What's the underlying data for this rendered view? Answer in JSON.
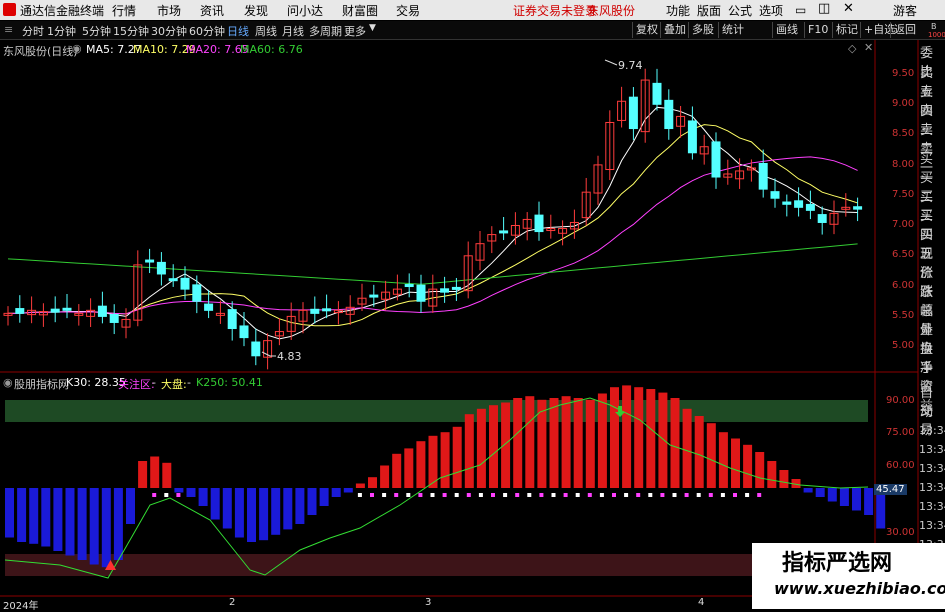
{
  "menubar": {
    "app_title": "通达信金融终端",
    "menus": [
      "行情",
      "市场",
      "资讯",
      "发现",
      "问小达",
      "财富圈",
      "交易"
    ],
    "notice": "证券交易未登录",
    "stock": "东风股份",
    "right": [
      "功能",
      "版面",
      "公式",
      "选项"
    ],
    "user": "游客"
  },
  "toolbar": {
    "periods": [
      "分时",
      "1分钟",
      "5分钟",
      "15分钟",
      "30分钟",
      "60分钟",
      "日线",
      "周线",
      "月线",
      "多周期",
      "更多"
    ],
    "selected": "日线",
    "buttons": [
      "复权",
      "叠加",
      "多股",
      "统计",
      "画线",
      "F10",
      "标记",
      "+自选",
      "返回"
    ]
  },
  "main_info": {
    "name": "东风股份(日线)",
    "ma5": "MA5: 7.27",
    "ma10": "MA10: 7.29",
    "ma20": "MA20: 7.65",
    "ma60": "MA60: 6.76",
    "high_label": "9.74",
    "low_label": "4.83"
  },
  "sub_info": {
    "name": "股朋指标网",
    "k30": "K30: 28.35",
    "attention": "关注区:",
    "dapan": "大盘:",
    "k250": "K250: 50.41",
    "value_tag": "45.47"
  },
  "right_panel": {
    "labels": [
      "委比",
      "卖五",
      "卖四",
      "卖三",
      "卖二",
      "卖一",
      "买一",
      "买二",
      "买三",
      "买四",
      "买五",
      "现价",
      "涨跌",
      "涨幅",
      "总量",
      "外盘",
      "换手",
      "净资",
      "收益",
      "自动",
      "交易"
    ],
    "times": [
      "13:34",
      "13:34",
      "13:34",
      "13:34",
      "13:34",
      "13:34",
      "13:34"
    ],
    "top_small": [
      "B",
      "1000"
    ]
  },
  "price_axis": [
    "9.50",
    "9.00",
    "8.50",
    "8.00",
    "7.50",
    "7.00",
    "6.50",
    "6.00",
    "5.50",
    "5.00"
  ],
  "sub_axis": [
    "90.00",
    "75.00",
    "60.00",
    "30.00"
  ],
  "date_axis": [
    "2024年",
    "2",
    "3",
    "4"
  ],
  "watermark": {
    "line1": "指标严选网",
    "line2": "www.xuezhibiao.com"
  },
  "colors": {
    "up": "#ff3c3c",
    "down": "#54ffff",
    "ma5": "#ffffff",
    "ma10": "#ffff66",
    "ma20": "#ff40ff",
    "ma60": "#33cc33"
  }
}
